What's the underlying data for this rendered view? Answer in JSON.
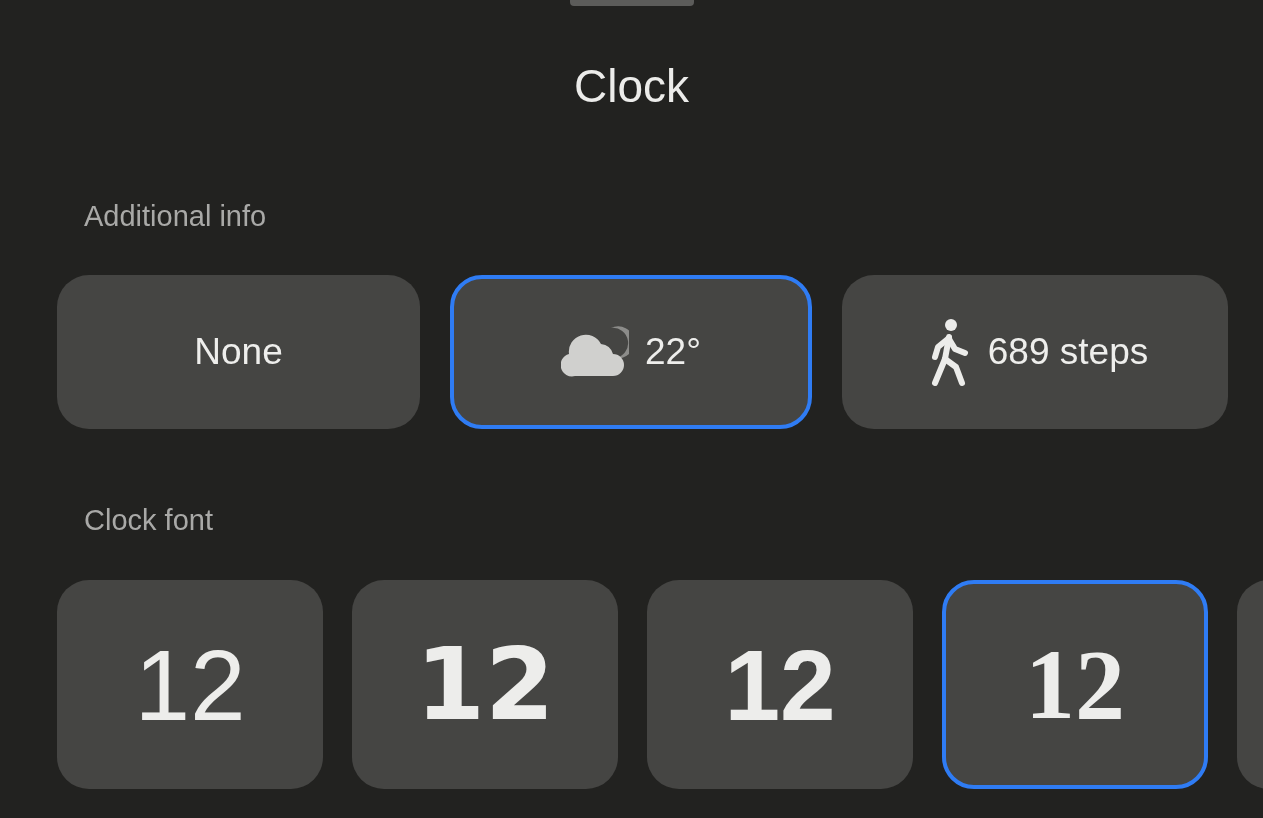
{
  "title": "Clock",
  "additional_info": {
    "label": "Additional info",
    "options": [
      {
        "kind": "none",
        "label": "None",
        "selected": false
      },
      {
        "kind": "weather",
        "label": "22°",
        "selected": true
      },
      {
        "kind": "steps",
        "label": "689 steps",
        "selected": false
      }
    ]
  },
  "clock_font": {
    "label": "Clock font",
    "options": [
      {
        "kind": "light",
        "label": "12",
        "selected": false
      },
      {
        "kind": "rounded",
        "label": "12",
        "selected": false
      },
      {
        "kind": "heavy",
        "label": "12",
        "selected": false
      },
      {
        "kind": "serif",
        "label": "12",
        "selected": true
      },
      {
        "selected": false
      }
    ]
  }
}
